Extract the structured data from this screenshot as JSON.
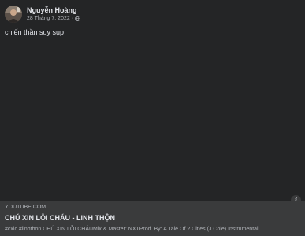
{
  "post": {
    "author": "Nguyễn Hoàng",
    "date": "28 Tháng 7, 2022",
    "separator": "·",
    "privacy_icon": "globe-icon",
    "text": "chiến thần suy sụp"
  },
  "link_preview": {
    "domain": "YOUTUBE.COM",
    "title": "CHÚ XIN LỖI CHÁU - LINH THỘN",
    "description": "#cxlc #linhthon CHÚ XIN LỖI CHÁUMix & Master: NXTProd. By: A Tale Of 2 Cities (J.Cole) Instrumental",
    "info_icon": "info-icon"
  },
  "colors": {
    "background": "#242526",
    "preview_background": "#3a3b3c",
    "primary_text": "#e4e6eb",
    "secondary_text": "#b0b3b8"
  }
}
